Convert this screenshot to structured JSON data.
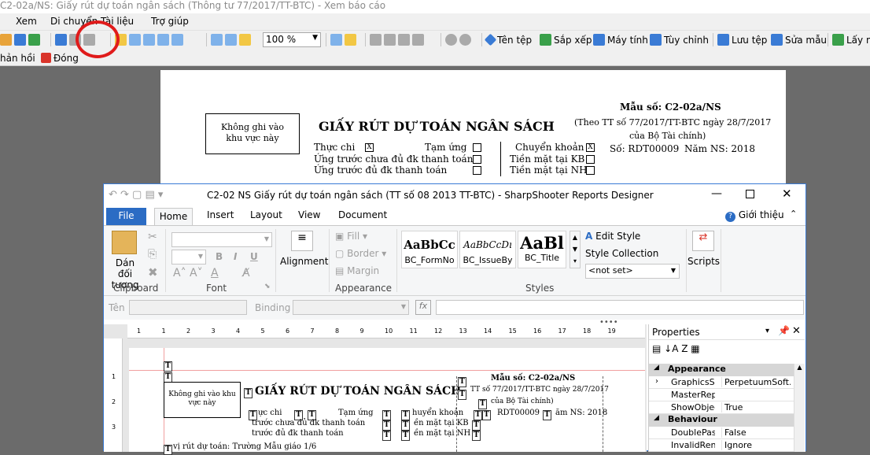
{
  "outer": {
    "title": "C2-02a/NS: Giấy rút dự toán ngân sách (Thông tư 77/2017/TT-BTC) - Xem báo cáo",
    "menu": [
      "Xem",
      "Di chuyển",
      "Tài liệu",
      "Trợ giúp"
    ],
    "zoom": "100 %",
    "toolbar_labels": [
      "Tên tệp",
      "Sắp xếp",
      "Máy tính",
      "Tùy chỉnh",
      "Lưu tệp",
      "Sửa mẫu",
      "Lấy m"
    ],
    "toolbar2_labels": [
      "hản hồi",
      "Đóng"
    ]
  },
  "report": {
    "stamp": "Không ghi vào khu vực này",
    "title": "GIẤY RÚT DỰ TOÁN NGÂN SÁCH",
    "form_no": "Mẫu số: C2-02a/NS",
    "regulation": "(Theo TT số 77/2017/TT-BTC ngày 28/7/2017",
    "issuer": "của Bộ Tài chính)",
    "options": {
      "thuc_chi": "Thực chi",
      "tam_ung": "Tạm ứng",
      "chuyen_khoan": "Chuyển khoản",
      "ung_chua_du": "Ứng trước chưa đủ đk thanh toán",
      "ung_du": "Ứng trước đủ đk thanh toán",
      "tien_mat_kb": "Tiền mặt tại KB",
      "tien_mat_nh": "Tiền mặt tại NH"
    },
    "check_mark": "X",
    "so": "Số: RDT00009",
    "nam": "Năm NS: 2018"
  },
  "designer": {
    "title": "C2-02 NS Giấy rút dự toán ngân sách (TT số 08 2013 TT-BTC) - SharpShooter Reports Designer",
    "tabs": [
      "File",
      "Home",
      "Insert",
      "Layout",
      "View",
      "Document"
    ],
    "about": "Giới thiệu",
    "ribbon": {
      "paste": "Dán đối tượng",
      "clipboard": "Clipboard",
      "font": "Font",
      "alignment": "Alignment",
      "fill": "Fill",
      "border": "Border",
      "margin": "Margin",
      "appearance": "Appearance",
      "styles_group": "Styles",
      "styles": [
        {
          "sample": "AaBbCc",
          "name": "BC_FormNo"
        },
        {
          "sample": "AaBbCcDı",
          "name": "BC_IssueBy"
        },
        {
          "sample": "AaBl",
          "name": "BC_Title"
        }
      ],
      "edit_style": "Edit Style",
      "style_collection": "Style Collection",
      "not_set": "<not set>",
      "scripts": "Scripts",
      "bold": "B",
      "italic": "I",
      "underline": "U"
    },
    "prop_bar": {
      "name_label": "Tên",
      "binding_label": "Binding",
      "fx": "fx"
    },
    "ruler": [
      "1",
      "1",
      "2",
      "3",
      "4",
      "5",
      "6",
      "7",
      "8",
      "9",
      "10",
      "11",
      "12",
      "13",
      "14",
      "15",
      "16",
      "17",
      "18",
      "19"
    ],
    "vruler": [
      "1",
      "2",
      "3"
    ],
    "page": {
      "stamp": "Không ghi vào khu vực này",
      "title": "GIẤY RÚT DỰ TOÁN NGÂN SÁCH",
      "form_no": "Mẫu số: C2-02a/NS",
      "regulation": "TT số 77/2017/TT-BTC ngày 28/7/2017",
      "issuer": "của Bộ Tài chính)",
      "l1": "ực chi",
      "l1b": "Tạm ứng",
      "l1c": "huyển khoản",
      "l2": "trước chưa đủ đk thanh toán",
      "l2c": "ền mặt tại KB",
      "l3": "trước đủ đk thanh toán",
      "l3c": "ền mặt tại NH",
      "so": "RDT00009",
      "nam": "ăm NS: 2018",
      "unit": "vị rút dự toán: Trường Mẫu giáo 1/6"
    },
    "properties": {
      "title": "Properties",
      "cat_appearance": "Appearance",
      "cat_behaviour": "Behaviour",
      "rows": [
        {
          "k": "GraphicsSett",
          "v": "PerpetuumSoft.Re"
        },
        {
          "k": "MasterRepor",
          "v": ""
        },
        {
          "k": "ShowObject",
          "v": "True"
        }
      ],
      "rows2": [
        {
          "k": "DoublePass",
          "v": "False"
        },
        {
          "k": "InvalidRende",
          "v": "Ignore"
        }
      ]
    }
  }
}
